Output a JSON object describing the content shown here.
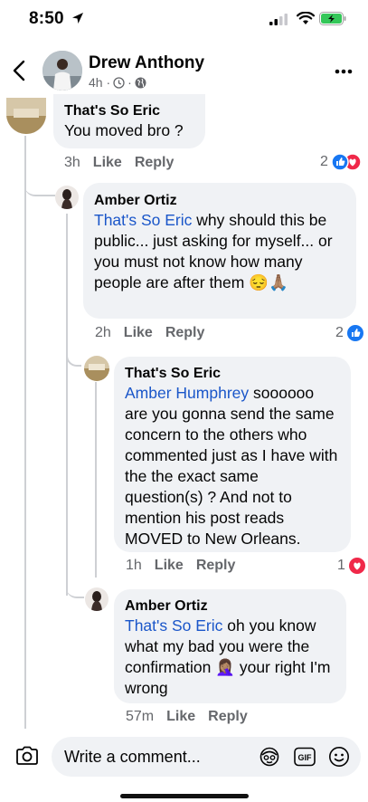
{
  "status_bar": {
    "time": "8:50"
  },
  "header": {
    "name": "Drew Anthony",
    "meta": "4h ·"
  },
  "comments": [
    {
      "author": "That's So Eric",
      "text": "You moved bro ?",
      "time": "3h",
      "like_label": "Like",
      "reply_label": "Reply",
      "reaction_count": "2"
    },
    {
      "author": "Amber Ortiz",
      "mention": "That's So Eric",
      "text": " why should this be public... just asking for myself... or you must not know how many people are after them 😔🙏🏽",
      "time": "2h",
      "like_label": "Like",
      "reply_label": "Reply",
      "reaction_count": "2"
    },
    {
      "author": "That's So Eric",
      "mention": "Amber Humphrey",
      "text": " soooooo are you gonna send the same concern to the others who commented just as I have with the the exact same question(s) ? And not to mention his post reads MOVED to New Orleans.",
      "time": "1h",
      "like_label": "Like",
      "reply_label": "Reply",
      "reaction_count": "1"
    },
    {
      "author": "Amber Ortiz",
      "mention": "That's So Eric",
      "text_before": " oh you know what my bad you were the confirmation ",
      "emoji": "🤦🏽‍♀️",
      "text_after": " your right I'm wrong",
      "time": "57m",
      "like_label": "Like",
      "reply_label": "Reply"
    }
  ],
  "composer": {
    "placeholder": "Write a comment..."
  },
  "colors": {
    "like_blue": "#1877f2",
    "love_red": "#f02849",
    "mention_blue": "#1a56c9"
  },
  "icons": [
    "location-arrow-icon",
    "signal-icon",
    "wifi-icon",
    "battery-icon",
    "back-chevron-icon",
    "clock-icon",
    "globe-icon",
    "more-icon",
    "like-reaction-icon",
    "love-reaction-icon",
    "camera-icon",
    "avatar-sticker-icon",
    "gif-icon",
    "emoji-icon"
  ]
}
